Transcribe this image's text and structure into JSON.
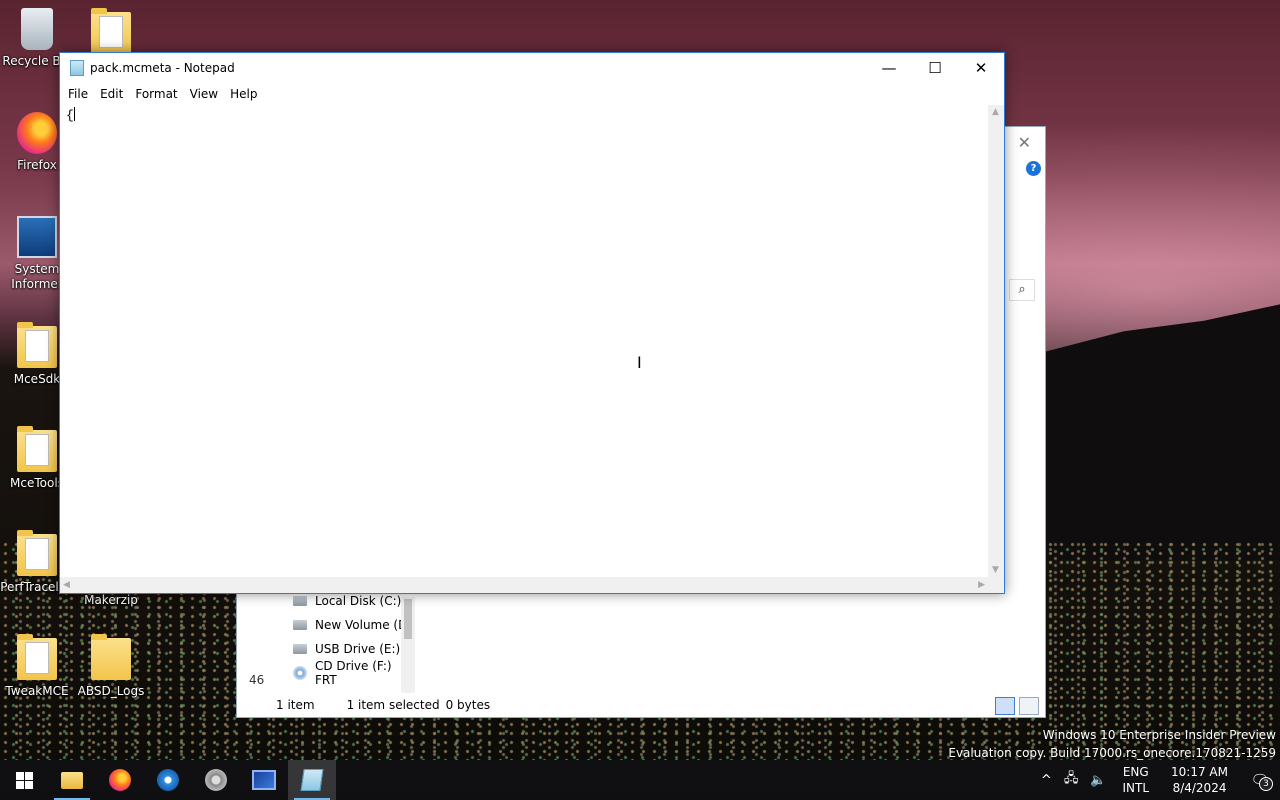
{
  "desktop": {
    "icons": [
      {
        "label": "Recycle Bin",
        "icon": "recycle-bin-icon"
      },
      {
        "label": "Firefox",
        "icon": "firefox-icon"
      },
      {
        "label": "System Informer",
        "icon": "system-informer-icon"
      },
      {
        "label": "MceSdk",
        "icon": "folder-icon"
      },
      {
        "label": "MceTools",
        "icon": "folder-icon"
      },
      {
        "label": "PerfTracelog",
        "icon": "folder-icon"
      },
      {
        "label": "TweakMCE",
        "icon": "folder-icon"
      },
      {
        "label": "Makerzip",
        "icon": "folder-icon"
      },
      {
        "label": "ABSD_Logs",
        "icon": "folder-icon"
      },
      {
        "label": "",
        "icon": "document-folder-icon"
      }
    ]
  },
  "explorer": {
    "nav_items": [
      {
        "label": "Local Disk (C:)",
        "icon": "hard-drive-icon"
      },
      {
        "label": "New Volume (D:",
        "icon": "hard-drive-icon"
      },
      {
        "label": "USB Drive (E:)",
        "icon": "usb-drive-icon"
      },
      {
        "label": "CD Drive (F:) FRT",
        "icon": "cd-drive-icon"
      }
    ],
    "status_items": "1 item",
    "status_selected": "1 item selected",
    "status_size": "0 bytes",
    "partial_text": "46",
    "close_glyph": "✕",
    "help_glyph": "?"
  },
  "notepad": {
    "title": "pack.mcmeta - Notepad",
    "menus": [
      "File",
      "Edit",
      "Format",
      "View",
      "Help"
    ],
    "content": "{",
    "controls": {
      "minimize": "—",
      "maximize": "☐",
      "close": "✕"
    },
    "cursor_glyph": "I",
    "accent": "#2f7ad1"
  },
  "watermark": {
    "line1": "Windows 10 Enterprise Insider Preview",
    "line2": "Evaluation copy. Build 17000.rs_onecore.170821-1259"
  },
  "taskbar": {
    "apps": [
      {
        "name": "start",
        "icon": "windows-start-icon"
      },
      {
        "name": "file-explorer",
        "icon": "file-explorer-icon"
      },
      {
        "name": "firefox",
        "icon": "firefox-icon"
      },
      {
        "name": "media-player",
        "icon": "media-player-icon"
      },
      {
        "name": "film-reel",
        "icon": "film-reel-icon"
      },
      {
        "name": "monitor-app",
        "icon": "monitor-icon"
      },
      {
        "name": "notepad",
        "icon": "notepad-icon"
      }
    ],
    "tray": {
      "chevron": "^",
      "language_line1": "ENG",
      "language_line2": "INTL",
      "time": "10:17 AM",
      "date": "8/4/2024",
      "notification_count": "3"
    }
  }
}
